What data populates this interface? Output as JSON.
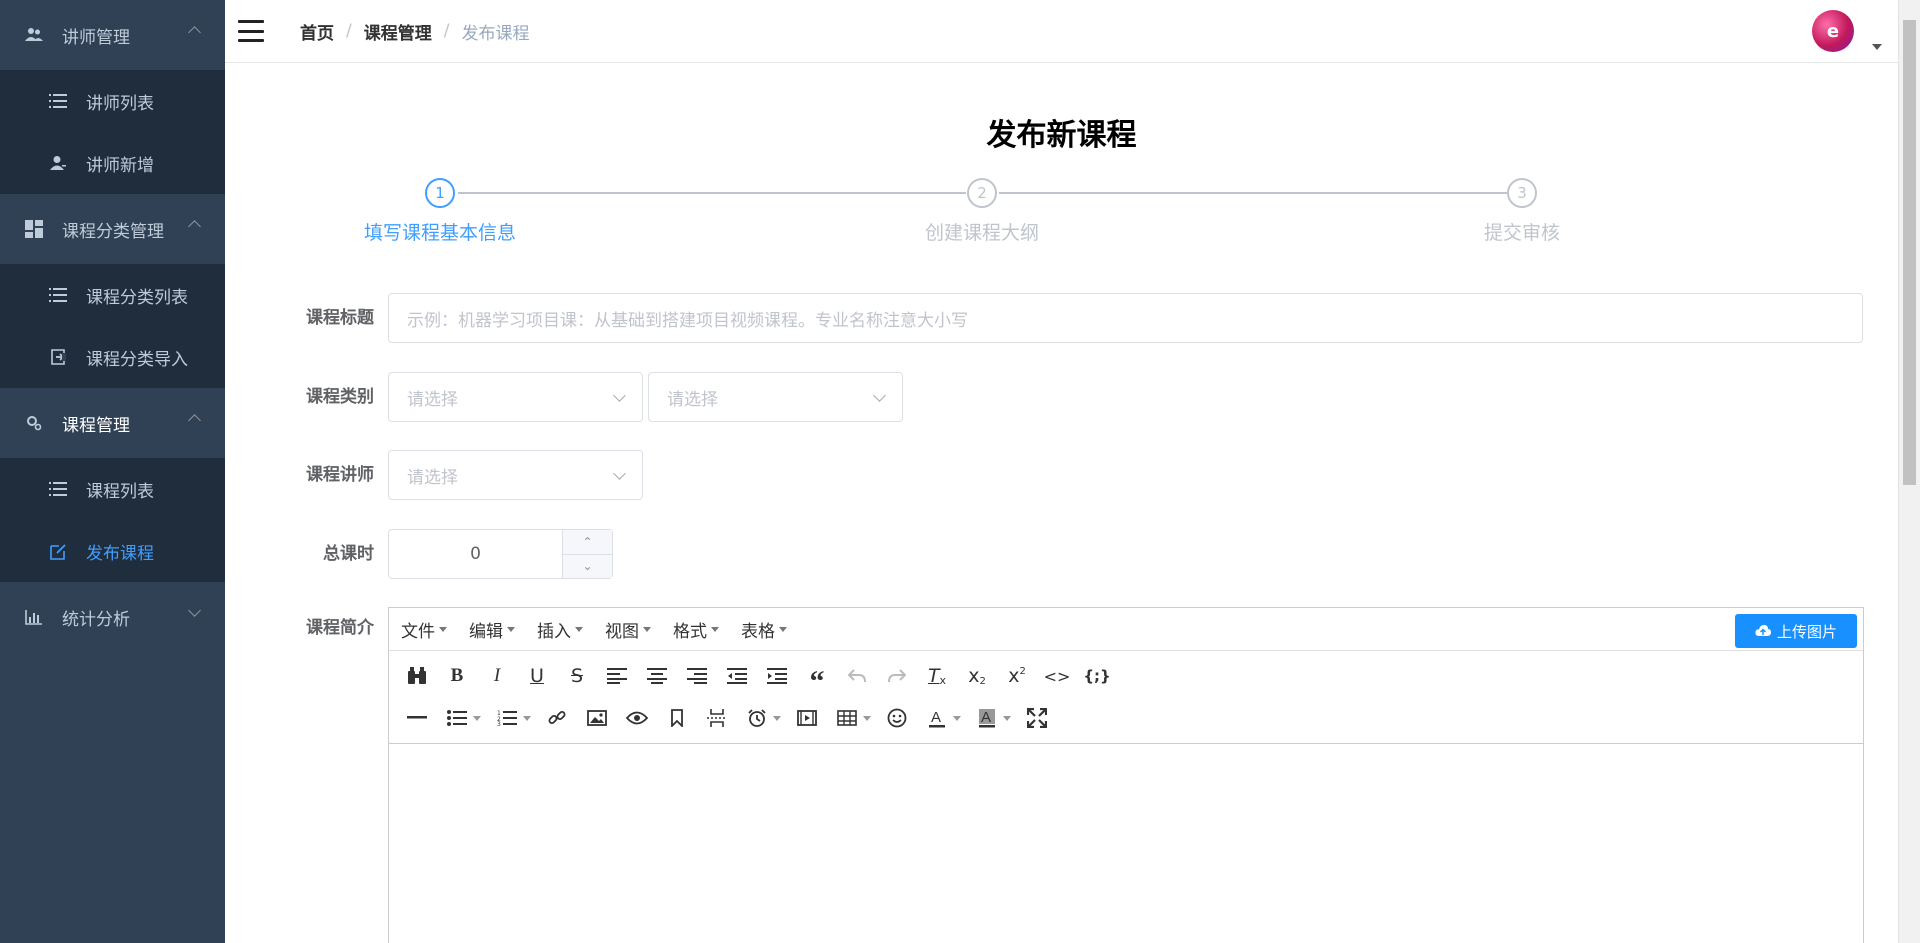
{
  "sidebar": {
    "groups": [
      {
        "label": "讲师管理",
        "icon": "users-icon",
        "expanded": true,
        "items": [
          {
            "label": "讲师列表",
            "icon": "list-icon"
          },
          {
            "label": "讲师新增",
            "icon": "user-add-icon"
          }
        ]
      },
      {
        "label": "课程分类管理",
        "icon": "dashboard-icon",
        "expanded": true,
        "items": [
          {
            "label": "课程分类列表",
            "icon": "list-icon"
          },
          {
            "label": "课程分类导入",
            "icon": "import-icon"
          }
        ]
      },
      {
        "label": "课程管理",
        "icon": "setting-icon",
        "expanded": true,
        "items": [
          {
            "label": "课程列表",
            "icon": "list-icon"
          },
          {
            "label": "发布课程",
            "icon": "edit-icon",
            "active": true
          }
        ]
      },
      {
        "label": "统计分析",
        "icon": "chart-icon",
        "expanded": false,
        "items": []
      }
    ]
  },
  "breadcrumb": [
    "首页",
    "课程管理",
    "发布课程"
  ],
  "page": {
    "title": "发布新课程"
  },
  "steps": [
    {
      "number": "1",
      "label": "填写课程基本信息",
      "active": true
    },
    {
      "number": "2",
      "label": "创建课程大纲",
      "active": false
    },
    {
      "number": "3",
      "label": "提交审核",
      "active": false
    }
  ],
  "form": {
    "title_label": "课程标题",
    "title_placeholder": "示例：机器学习项目课：从基础到搭建项目视频课程。专业名称注意大小写",
    "category_label": "课程类别",
    "category1_placeholder": "请选择",
    "category2_placeholder": "请选择",
    "teacher_label": "课程讲师",
    "teacher_placeholder": "请选择",
    "hours_label": "总课时",
    "hours_value": "0",
    "intro_label": "课程简介"
  },
  "editor": {
    "menus": [
      "文件",
      "编辑",
      "插入",
      "视图",
      "格式",
      "表格"
    ],
    "upload_label": "上传图片",
    "accent": "#1890ff"
  },
  "colors": {
    "sidebar": "#304156",
    "submenu": "#1f2d3d",
    "active": "#409eff"
  }
}
